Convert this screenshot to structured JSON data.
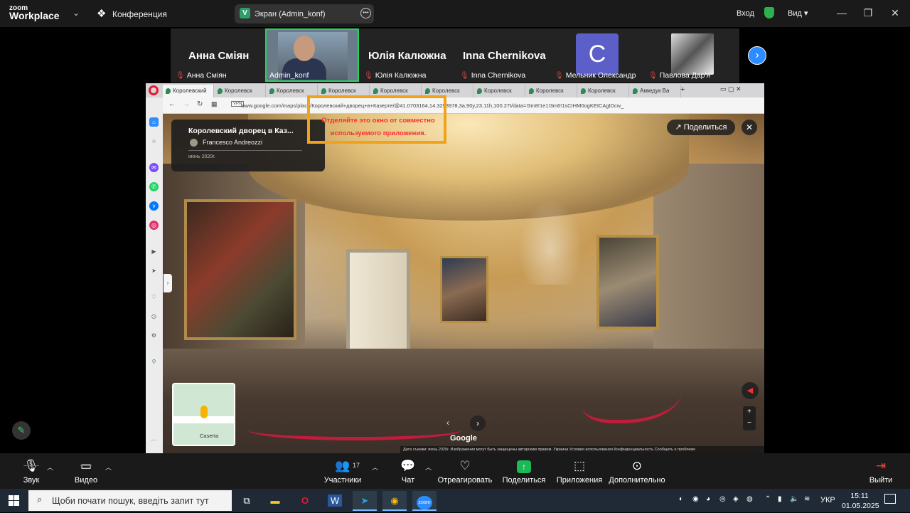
{
  "zoom": {
    "logo_line1": "zoom",
    "logo_line2": "Workplace",
    "meeting_label": "Конференция",
    "share_badge": "V",
    "share_label": "Экран (Admin_konf)",
    "login_label": "Вход",
    "view_label": "Вид ▾",
    "win_min": "—",
    "win_restore": "❐",
    "win_close": "✕"
  },
  "participants": {
    "tiles": [
      {
        "big_name": "Анна Сміян",
        "small_name": "Анна Сміян"
      },
      {
        "big_name": "",
        "small_name": "Admin_konf"
      },
      {
        "big_name": "Юлія Калюжна",
        "small_name": "Юлія Калюжна"
      },
      {
        "big_name": "Inna Chernikova",
        "small_name": "Inna Chernikova"
      },
      {
        "avatar_letter": "C",
        "small_name": "Мельник Олександр"
      },
      {
        "small_name": "Павлова Дар'я"
      }
    ],
    "next": "›"
  },
  "browser": {
    "tabs": [
      "Королевский",
      "Королевск",
      "Королевск",
      "Королевск",
      "Королевск",
      "Королевск",
      "Королевск",
      "Королевск",
      "Королевск",
      "Акведук Ва"
    ],
    "new_tab": "+",
    "vpn": "VPN",
    "address": "www.google.com/maps/place/Королевский+дворец+в+Казерте/@41.0703164,14.3253978,3a,90y,23.11h,100.27t/data=!3m8!1e1!3m6!1sCIHM0ogKEICAgIDcw_",
    "win_controls": "▭ ▢ ✕"
  },
  "streetview": {
    "title": "Королевский дворец в Каз...",
    "author": "Francesco Andreozzi",
    "date": "июнь 2020г.",
    "warning": "Отделяйте это окно от совместно используемого приложения.",
    "share_label": "Поделиться",
    "close": "✕",
    "minimap_label": "Caserta",
    "google_mark": "Google",
    "footer": "Дата съемки: июнь 2020г.    Изображения могут быть защищены авторским правом.    Украина    Условия использования    Конфиденциальность    Сообщить о проблеме",
    "zoom_in": "+",
    "zoom_out": "−",
    "nav_left": "‹",
    "nav_right": "›",
    "compass": "◀"
  },
  "toolbar": {
    "audio": "Звук",
    "video": "Видео",
    "participants": "Участники",
    "participants_count": "17",
    "chat": "Чат",
    "react": "Отреагировать",
    "share": "Поделиться",
    "apps": "Приложения",
    "more": "Дополнительно",
    "leave": "Выйти"
  },
  "taskbar": {
    "search_placeholder": "Щоби почати пошук, введіть запит тут",
    "lang": "УКР",
    "time": "15:11",
    "date": "01.05.2025",
    "zoom_app": "zoom",
    "word_app": "W"
  },
  "colors": {
    "zoom_blue": "#2d8cff",
    "active_speaker": "#2ad063",
    "share_green": "#1db954",
    "warning_border": "#f0a21a",
    "warning_text": "#ff2d2d",
    "rope_red": "#c01c3c"
  }
}
